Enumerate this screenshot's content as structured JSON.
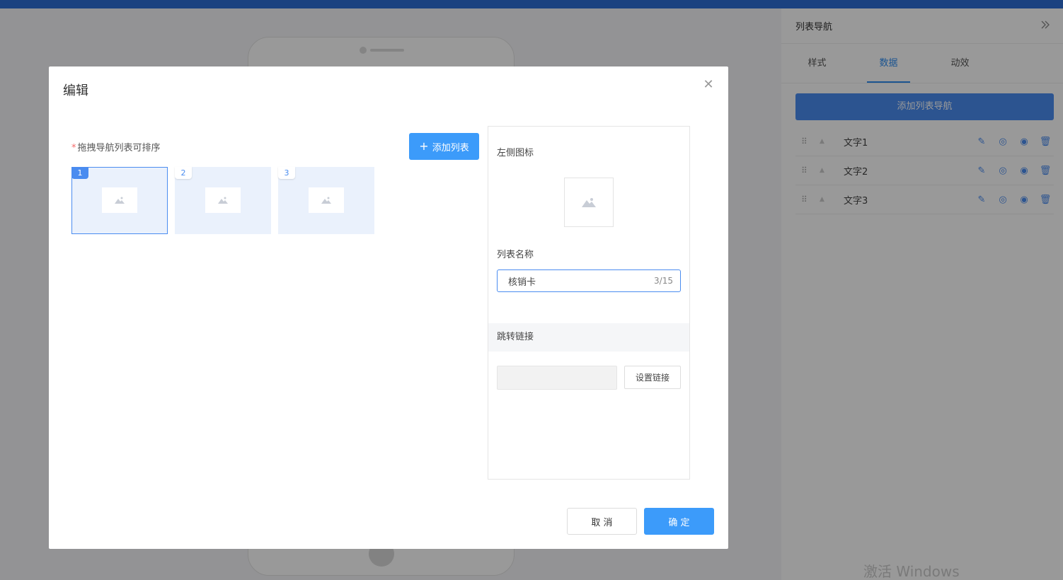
{
  "background": {
    "right_panel": {
      "title": "列表导航",
      "tabs": [
        "样式",
        "数据",
        "动效"
      ],
      "active_tab": "数据",
      "add_button": "添加列表导航",
      "rows": [
        {
          "label": "文字1"
        },
        {
          "label": "文字2"
        },
        {
          "label": "文字3"
        }
      ]
    },
    "watermark": "激活 Windows"
  },
  "modal": {
    "title": "编辑",
    "hint_star": "*",
    "hint": "拖拽导航列表可排序",
    "add_list_button": "添加列表",
    "thumbnails": [
      {
        "index": "1",
        "active": true
      },
      {
        "index": "2",
        "active": false
      },
      {
        "index": "3",
        "active": false
      }
    ],
    "form": {
      "left_icon_label": "左侧图标",
      "list_name_label": "列表名称",
      "list_name_value": "核销卡",
      "list_name_count": "3/15",
      "jump_link_label": "跳转链接",
      "set_link_button": "设置链接"
    },
    "cancel_button": "取 消",
    "confirm_button": "确 定"
  },
  "colors": {
    "accent": "#3c9bfa",
    "topbar": "#2e6fd6",
    "thumb_bg": "#eaf1fc",
    "required": "#f56c6c"
  }
}
